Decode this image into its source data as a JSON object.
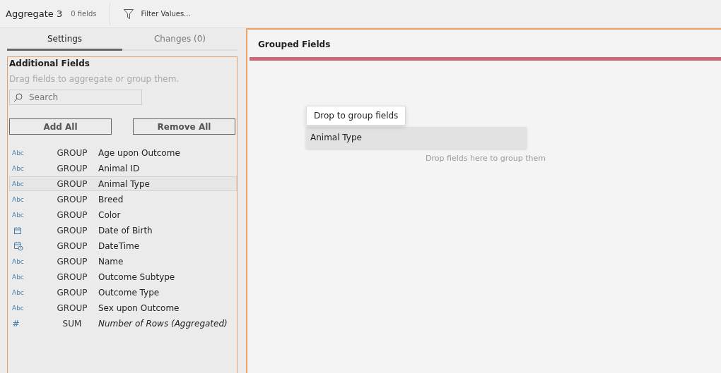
{
  "toolbar": {
    "title": "Aggregate 3",
    "field_count": "0 fields",
    "filter_button": "Filter Values..."
  },
  "tabs": [
    {
      "label": "Settings",
      "selected": true
    },
    {
      "label": "Changes (0)",
      "selected": false
    }
  ],
  "additional_fields": {
    "heading": "Additional Fields",
    "hint": "Drag fields to aggregate or group them.",
    "search": {
      "placeholder": "Search"
    },
    "buttons": [
      "Add All",
      "Remove All"
    ],
    "fields": [
      {
        "kind": "text",
        "type_label": "Abc",
        "aggregation": "GROUP",
        "name": "Age upon Outcome",
        "selected": false
      },
      {
        "kind": "text",
        "type_label": "Abc",
        "aggregation": "GROUP",
        "name": "Animal ID",
        "selected": false
      },
      {
        "kind": "text",
        "type_label": "Abc",
        "aggregation": "GROUP",
        "name": "Animal Type",
        "selected": true
      },
      {
        "kind": "text",
        "type_label": "Abc",
        "aggregation": "GROUP",
        "name": "Breed",
        "selected": false
      },
      {
        "kind": "text",
        "type_label": "Abc",
        "aggregation": "GROUP",
        "name": "Color",
        "selected": false
      },
      {
        "kind": "date",
        "aggregation": "GROUP",
        "name": "Date of Birth",
        "selected": false
      },
      {
        "kind": "datetime",
        "aggregation": "GROUP",
        "name": "DateTime",
        "selected": false
      },
      {
        "kind": "text",
        "type_label": "Abc",
        "aggregation": "GROUP",
        "name": "Name",
        "selected": false
      },
      {
        "kind": "text",
        "type_label": "Abc",
        "aggregation": "GROUP",
        "name": "Outcome Subtype",
        "selected": false
      },
      {
        "kind": "text",
        "type_label": "Abc",
        "aggregation": "GROUP",
        "name": "Outcome Type",
        "selected": false
      },
      {
        "kind": "text",
        "type_label": "Abc",
        "aggregation": "GROUP",
        "name": "Sex upon Outcome",
        "selected": false
      },
      {
        "kind": "number",
        "type_label": "#",
        "aggregation": "SUM",
        "name": "Number of Rows (Aggregated)",
        "selected": false
      }
    ]
  },
  "grouped_fields": {
    "heading": "Grouped Fields",
    "drop_tooltip": "Drop to group fields",
    "dragged_field": "Animal Type",
    "empty_hint": "Drop fields here to group them"
  }
}
